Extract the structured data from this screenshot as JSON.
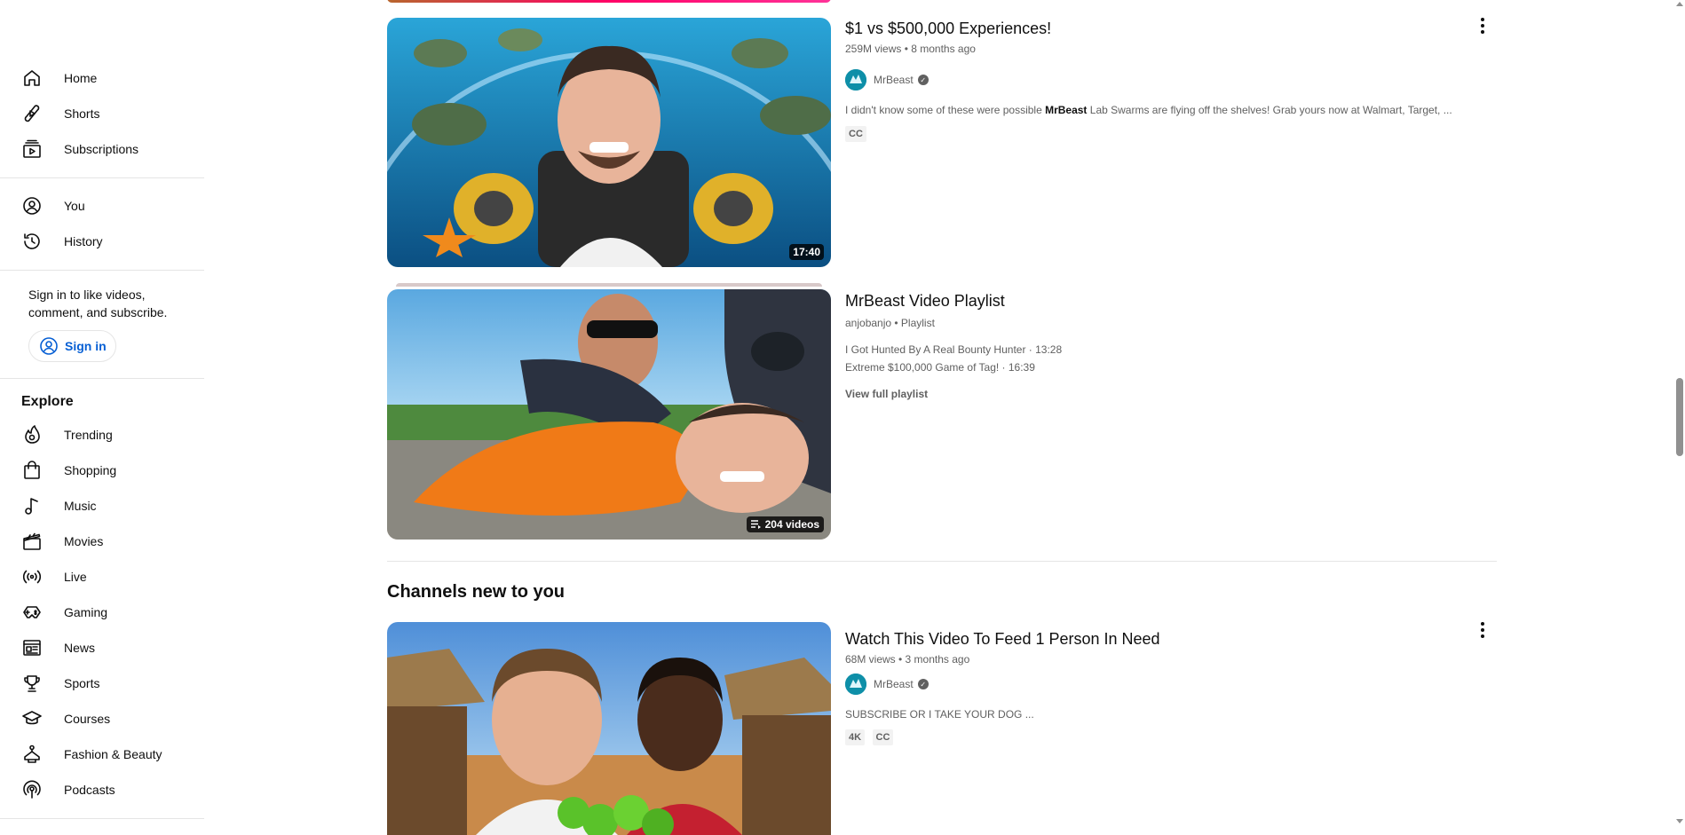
{
  "sidebar": {
    "main": [
      {
        "label": "Home",
        "icon": "home-icon"
      },
      {
        "label": "Shorts",
        "icon": "shorts-icon"
      },
      {
        "label": "Subscriptions",
        "icon": "subscriptions-icon"
      }
    ],
    "you": [
      {
        "label": "You",
        "icon": "user-icon"
      },
      {
        "label": "History",
        "icon": "history-icon"
      }
    ],
    "signin_text": "Sign in to like videos, comment, and subscribe.",
    "signin_button": "Sign in",
    "explore_title": "Explore",
    "explore": [
      {
        "label": "Trending",
        "icon": "trending-icon"
      },
      {
        "label": "Shopping",
        "icon": "shopping-bag-icon"
      },
      {
        "label": "Music",
        "icon": "music-note-icon"
      },
      {
        "label": "Movies",
        "icon": "clapperboard-icon"
      },
      {
        "label": "Live",
        "icon": "live-icon"
      },
      {
        "label": "Gaming",
        "icon": "gamepad-icon"
      },
      {
        "label": "News",
        "icon": "newspaper-icon"
      },
      {
        "label": "Sports",
        "icon": "trophy-icon"
      },
      {
        "label": "Courses",
        "icon": "graduation-cap-icon"
      },
      {
        "label": "Fashion & Beauty",
        "icon": "hanger-icon"
      },
      {
        "label": "Podcasts",
        "icon": "podcast-icon"
      }
    ]
  },
  "videos": [
    {
      "title": "$1 vs $500,000 Experiences!",
      "meta": "259M views • 8 months ago",
      "channel": "MrBeast",
      "desc_prefix": "I didn't know some of these were possible ",
      "desc_bold": "MrBeast",
      "desc_suffix": " Lab Swarms are flying off the shelves! Grab yours now at Walmart, Target, ...",
      "badges": [
        "CC"
      ],
      "duration": "17:40"
    },
    {
      "title": "Watch This Video To Feed 1 Person In Need",
      "meta": "68M views • 3 months ago",
      "channel": "MrBeast",
      "desc": "SUBSCRIBE OR I TAKE YOUR DOG ...",
      "badges": [
        "4K",
        "CC"
      ]
    }
  ],
  "playlist": {
    "title": "MrBeast Video Playlist",
    "meta": "anjobanjo • Playlist",
    "items": [
      "I Got Hunted By A Real Bounty Hunter · 13:28",
      "Extreme $100,000 Game of Tag! · 16:39"
    ],
    "view_full": "View full playlist",
    "count": "204 videos"
  },
  "shelf_title": "Channels new to you"
}
